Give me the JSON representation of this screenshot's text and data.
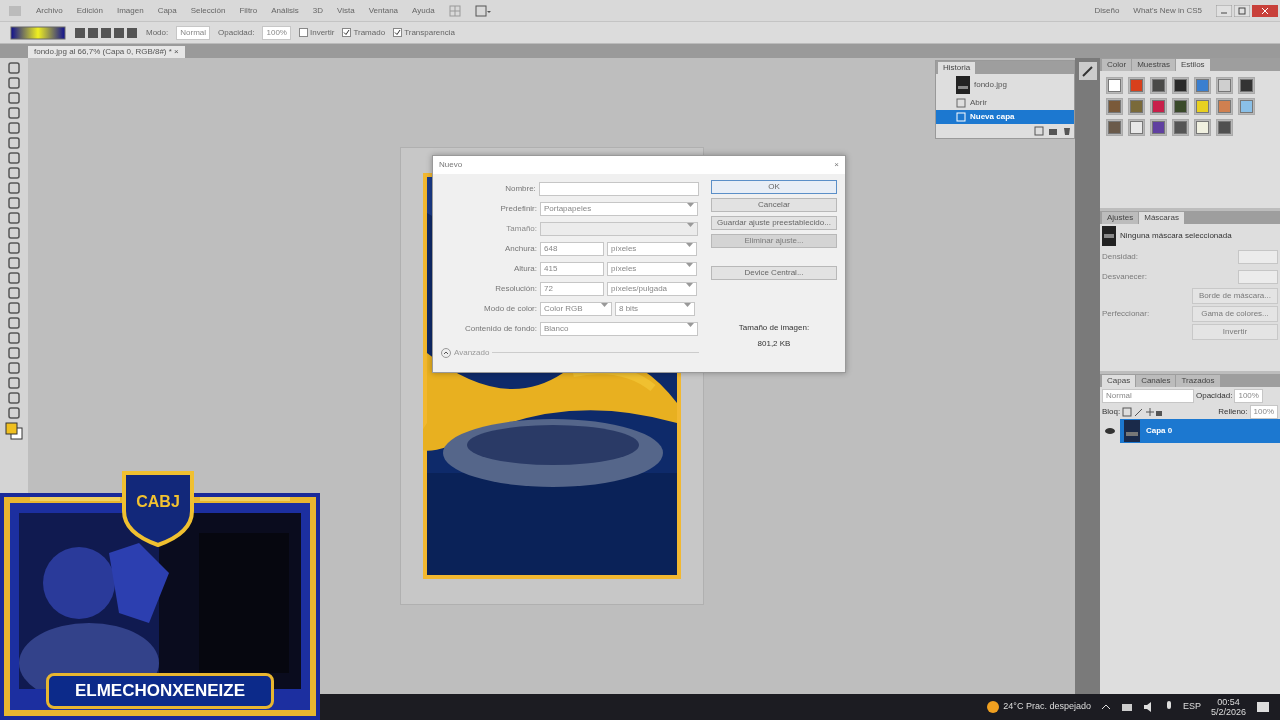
{
  "menu_bar": {
    "items": [
      "Archivo",
      "Edición",
      "Imagen",
      "Capa",
      "Selección",
      "Filtro",
      "Análisis",
      "3D",
      "Vista",
      "Ventana",
      "Ayuda"
    ],
    "workspace": "Diseño",
    "whats_new": "What's New in CS5"
  },
  "options_bar": {
    "mode_label": "Modo:",
    "mode": "Normal",
    "opacity_label": "Opacidad:",
    "opacity": "100%",
    "checkboxes": [
      {
        "label": "Invertir",
        "checked": false
      },
      {
        "label": "Tramado",
        "checked": true
      },
      {
        "label": "Transparencia",
        "checked": true
      }
    ]
  },
  "document_tab": {
    "title": "fondo.jpg al 66,7% (Capa 0, RGB/8#) *",
    "close": "×"
  },
  "new_dialog": {
    "title": "Nuevo",
    "close": "×",
    "rows": [
      {
        "kind": "input",
        "label": "Nombre:",
        "disabled": false
      },
      {
        "kind": "select",
        "label": "Predefinir:",
        "value": "Portapapeles",
        "disabled": false
      },
      {
        "kind": "select",
        "label": "Tamaño:",
        "disabled": true
      },
      {
        "kind": "measure",
        "label": "Anchura:",
        "value": "648",
        "unit": "píxeles",
        "disabled": false
      },
      {
        "kind": "measure",
        "label": "Altura:",
        "value": "415",
        "unit": "píxeles",
        "disabled": false
      },
      {
        "kind": "measure",
        "label": "Resolución:",
        "value": "72",
        "unit": "píxeles/pulgada",
        "disabled": false
      },
      {
        "kind": "pair",
        "label": "Modo de color:",
        "value": "Color RGB",
        "unit": "8 bits",
        "disabled": false
      },
      {
        "kind": "select",
        "label": "Contenido de fondo:",
        "value": "Blanco",
        "disabled": false
      }
    ],
    "advanced": {
      "label": "Avanzado",
      "expanded": false
    },
    "buttons": [
      {
        "label": "OK",
        "default": true,
        "disabled": false
      },
      {
        "label": "Cancelar",
        "default": false,
        "disabled": false
      },
      {
        "label": "Guardar ajuste preestablecido...",
        "default": false,
        "disabled": false
      },
      {
        "label": "Eliminar ajuste...",
        "default": false,
        "disabled": true
      },
      {
        "label": "Device Central...",
        "default": false,
        "disabled": false
      }
    ],
    "image_size_label": "Tamaño de imagen:",
    "image_size": "801,2 KB"
  },
  "history_panel": {
    "title": "Historia",
    "items": [
      {
        "kind": "snapshot",
        "label": "fondo.jpg",
        "selected": false
      },
      {
        "kind": "step",
        "label": "Abrir",
        "selected": false
      },
      {
        "kind": "step",
        "label": "Nueva capa",
        "selected": true
      }
    ]
  },
  "styles_panel": {
    "tabs": [
      {
        "label": "Color",
        "selected": false
      },
      {
        "label": "Muestras",
        "selected": false
      },
      {
        "label": "Estilos",
        "selected": true
      }
    ],
    "styles": [
      {
        "color": "#ffffff"
      },
      {
        "color": "#d8401c"
      },
      {
        "color": "#4a4a48"
      },
      {
        "color": "#2a2a2a"
      },
      {
        "color": "#3a7fd0"
      },
      {
        "color": "#cfcfcf"
      },
      {
        "color": "#333333"
      },
      {
        "color": "#7a5a3a"
      },
      {
        "color": "#7a6a3a"
      },
      {
        "color": "#c8204a"
      },
      {
        "color": "#3a4a2a"
      },
      {
        "color": "#e8d020"
      },
      {
        "color": "#d08050"
      },
      {
        "color": "#8ac0e8"
      },
      {
        "color": "#6a5a4a"
      },
      {
        "color": "#e8e8e8"
      },
      {
        "color": "#6040a0"
      },
      {
        "color": "#555555"
      },
      {
        "color": "#f0f0e0"
      },
      {
        "color": "#505050"
      }
    ]
  },
  "masks_panel": {
    "tabs": [
      {
        "label": "Ajustes",
        "selected": false
      },
      {
        "label": "Máscaras",
        "selected": true
      }
    ],
    "message": "Ninguna máscara seleccionada",
    "labels": [
      "Densidad:",
      "Desvanecer:",
      "Perfeccionar:"
    ],
    "buttons": [
      "Borde de máscara...",
      "Gama de colores...",
      "Invertir"
    ]
  },
  "layers_panel": {
    "tabs": [
      {
        "label": "Capas",
        "selected": true
      },
      {
        "label": "Canales",
        "selected": false
      },
      {
        "label": "Trazados",
        "selected": false
      }
    ],
    "blend": "Normal",
    "opacity_label": "Opacidad:",
    "opacity": "100%",
    "lock_label": "Bloq:",
    "fill_label": "Relleno:",
    "fill": "100%",
    "layers": [
      {
        "name": "Capa 0",
        "selected": true,
        "visible": true
      }
    ]
  },
  "taskbar": {
    "weather": "24°C Prac. despejado",
    "language": "ESP",
    "time": "00:54",
    "date": "5/2/2026"
  },
  "stream_overlay": {
    "badge": "CABJ",
    "name": "ELMECHONXENEIZE"
  }
}
